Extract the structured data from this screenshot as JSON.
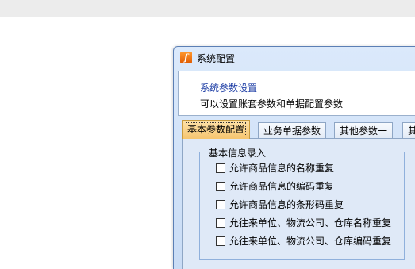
{
  "window": {
    "title": "系统配置",
    "icon": "app-logo-icon"
  },
  "header": {
    "title": "系统参数设置",
    "description": "可以设置账套参数和单据配置参数"
  },
  "tabs": [
    {
      "label": "基本参数配置",
      "active": true
    },
    {
      "label": "业务单据参数",
      "active": false
    },
    {
      "label": "其他参数一",
      "active": false
    },
    {
      "label": "其",
      "active": false
    }
  ],
  "group": {
    "title": "基本信息录入",
    "options": [
      {
        "label": "允许商品信息的名称重复",
        "checked": false
      },
      {
        "label": "允许商品信息的编码重复",
        "checked": false
      },
      {
        "label": "允许商品信息的条形码重复",
        "checked": false
      },
      {
        "label": "允往来单位、物流公司、仓库名称重复",
        "checked": false
      },
      {
        "label": "允往来单位、物流公司、仓库编码重复",
        "checked": false
      }
    ]
  }
}
